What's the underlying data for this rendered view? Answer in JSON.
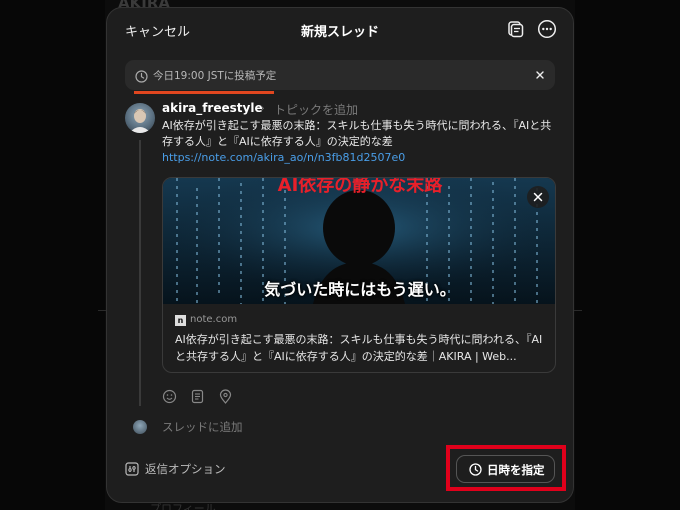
{
  "background": {
    "top_text": "AKIRA",
    "bottom_text": "プロフィール"
  },
  "header": {
    "cancel_label": "キャンセル",
    "title": "新規スレッド",
    "drafts_icon": "drafts-icon",
    "more_icon": "more-icon"
  },
  "schedule_banner": {
    "text": "今日19:00 JSTに投稿予定",
    "accent_color": "#e0461f"
  },
  "post": {
    "username": "akira_freestyle",
    "topic_placeholder": "トピックを追加",
    "text": "AI依存が引き起こす最悪の末路：スキルも仕事も失う時代に問われる、『AIと共存する人』と『AIに依存する人』の決定的な差",
    "link": "https://note.com/akira_ao/n/n3fb81d2507e0",
    "link_color": "#4a9ee8"
  },
  "link_card": {
    "image_top_text": "AI依存の静かな末路",
    "image_caption": "気づいた時にはもう遅い。",
    "source": "note.com",
    "title": "AI依存が引き起こす最悪の末路：スキルも仕事も失う時代に問われる、『AIと共存する人』と『AIに依存する人』の決定的な差｜AKIRA | Web..."
  },
  "attachments": [
    "gif-icon",
    "document-icon",
    "location-icon"
  ],
  "add_thread_label": "スレッドに追加",
  "footer": {
    "reply_options_label": "返信オプション",
    "schedule_button_label": "日時を指定",
    "highlight_color": "#e0001b"
  }
}
